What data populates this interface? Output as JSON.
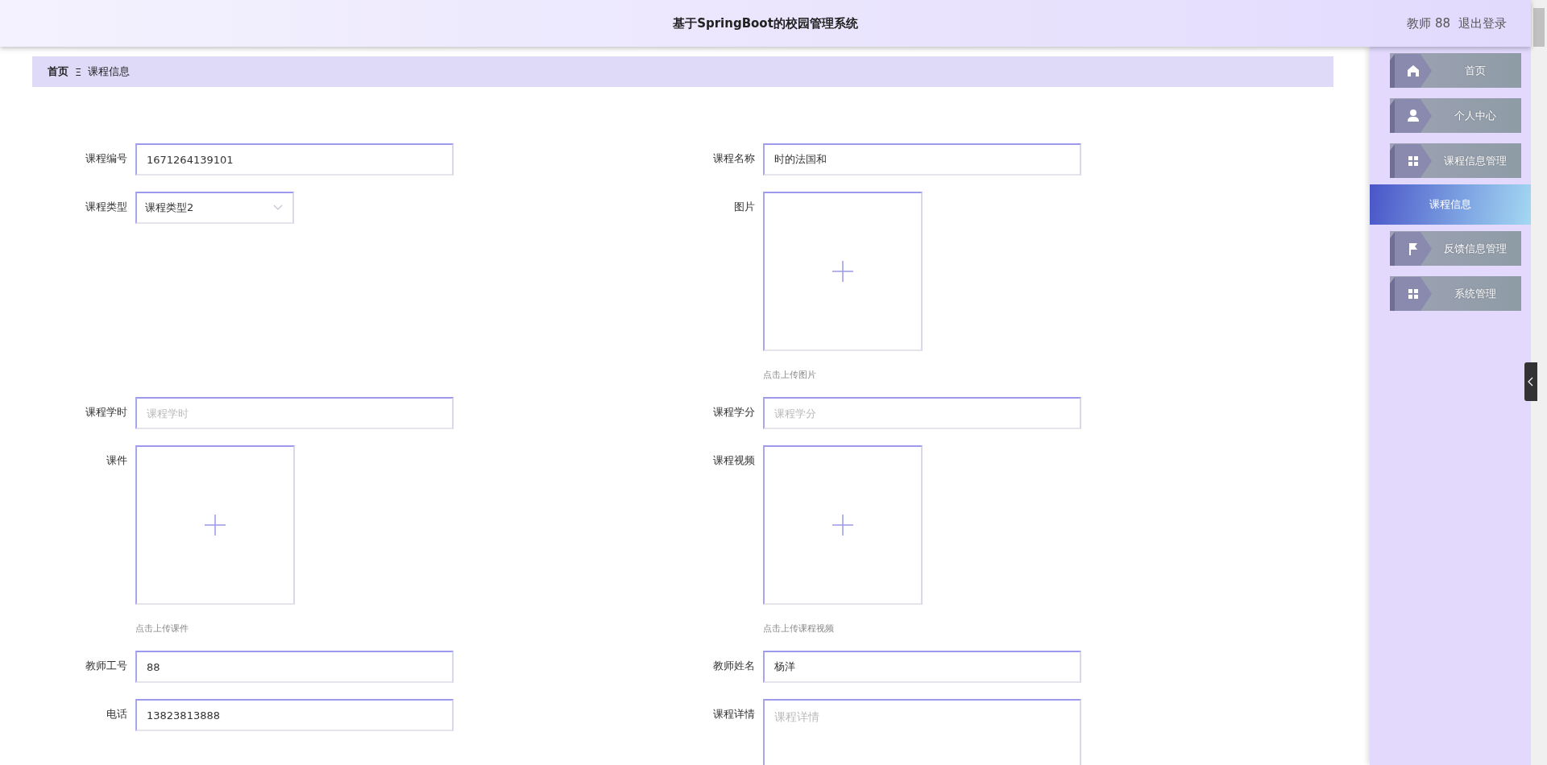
{
  "header": {
    "title": "基于SpringBoot的校园管理系统",
    "user": "教师 88",
    "logout": "退出登录"
  },
  "breadcrumb": {
    "home": "首页",
    "separator": "Ξ",
    "current": "课程信息"
  },
  "menu": [
    {
      "label": "首页",
      "kind": "home",
      "selected": false
    },
    {
      "label": "个人中心",
      "kind": "user",
      "selected": false
    },
    {
      "label": "课程信息管理",
      "kind": "grid",
      "selected": false
    },
    {
      "label": "课程信息",
      "kind": "sub",
      "selected": true
    },
    {
      "label": "反馈信息管理",
      "kind": "flag",
      "selected": false
    },
    {
      "label": "系统管理",
      "kind": "grid",
      "selected": false
    }
  ],
  "form": [
    {
      "label": "课程编号",
      "kind": "input",
      "value": "1671264139101"
    },
    {
      "label": "课程名称",
      "kind": "input",
      "value": "时的法国和"
    },
    {
      "label": "课程类型",
      "kind": "select",
      "value": "课程类型2"
    },
    {
      "label": "图片",
      "kind": "upload",
      "hint": "点击上传图片"
    },
    {
      "label": "课程学时",
      "kind": "input",
      "placeholder": "课程学时"
    },
    {
      "label": "课程学分",
      "kind": "input",
      "placeholder": "课程学分"
    },
    {
      "label": "课件",
      "kind": "upload",
      "hint": "点击上传课件"
    },
    {
      "label": "课程视频",
      "kind": "upload",
      "hint": "点击上传课程视频"
    },
    {
      "label": "教师工号",
      "kind": "input",
      "value": "88"
    },
    {
      "label": "教师姓名",
      "kind": "input",
      "value": "杨洋"
    },
    {
      "label": "电话",
      "kind": "input",
      "value": "13823813888"
    },
    {
      "label": "课程详情",
      "kind": "textarea",
      "placeholder": "课程详情"
    }
  ]
}
